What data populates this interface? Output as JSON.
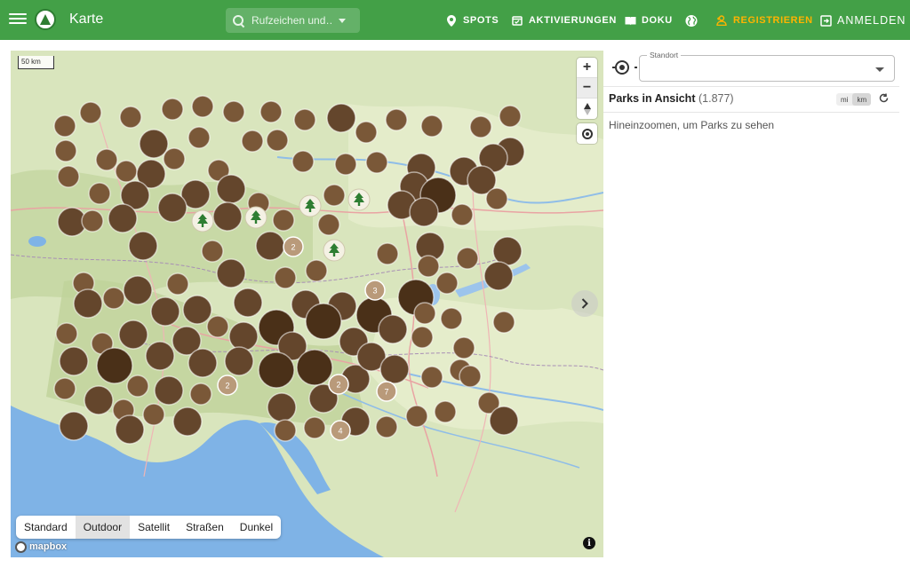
{
  "header": {
    "title": "Karte",
    "search_placeholder": "Rufzeichen und…",
    "nav": [
      {
        "label": "SPOTS",
        "icon": "map-pin-icon"
      },
      {
        "label": "AKTIVIERUNGEN",
        "icon": "calendar-check-icon"
      },
      {
        "label": "DOKU",
        "icon": "book-icon"
      },
      {
        "label": "REGISTRIEREN",
        "icon": "add-person-icon",
        "color": "#ffb300"
      },
      {
        "label": "ANMELDEN",
        "icon": "login-icon"
      }
    ],
    "colors": {
      "bar": "#43a047",
      "highlight": "#ffb300"
    }
  },
  "map": {
    "scale_label": "50 km",
    "style_options": [
      "Standard",
      "Outdoor",
      "Satellit",
      "Straßen",
      "Dunkel"
    ],
    "active_style": "Outdoor",
    "attribution": "mapbox",
    "info_label": "i",
    "cluster_labels": [
      "2",
      "3",
      "2",
      "2",
      "7",
      "4"
    ]
  },
  "panel": {
    "location_label": "Standort",
    "location_value": "",
    "parks_title": "Parks in Ansicht",
    "parks_count": "(1.877)",
    "units": [
      "mi",
      "km"
    ],
    "active_unit": "km",
    "zoom_hint": "Hineinzoomen, um Parks zu sehen"
  }
}
